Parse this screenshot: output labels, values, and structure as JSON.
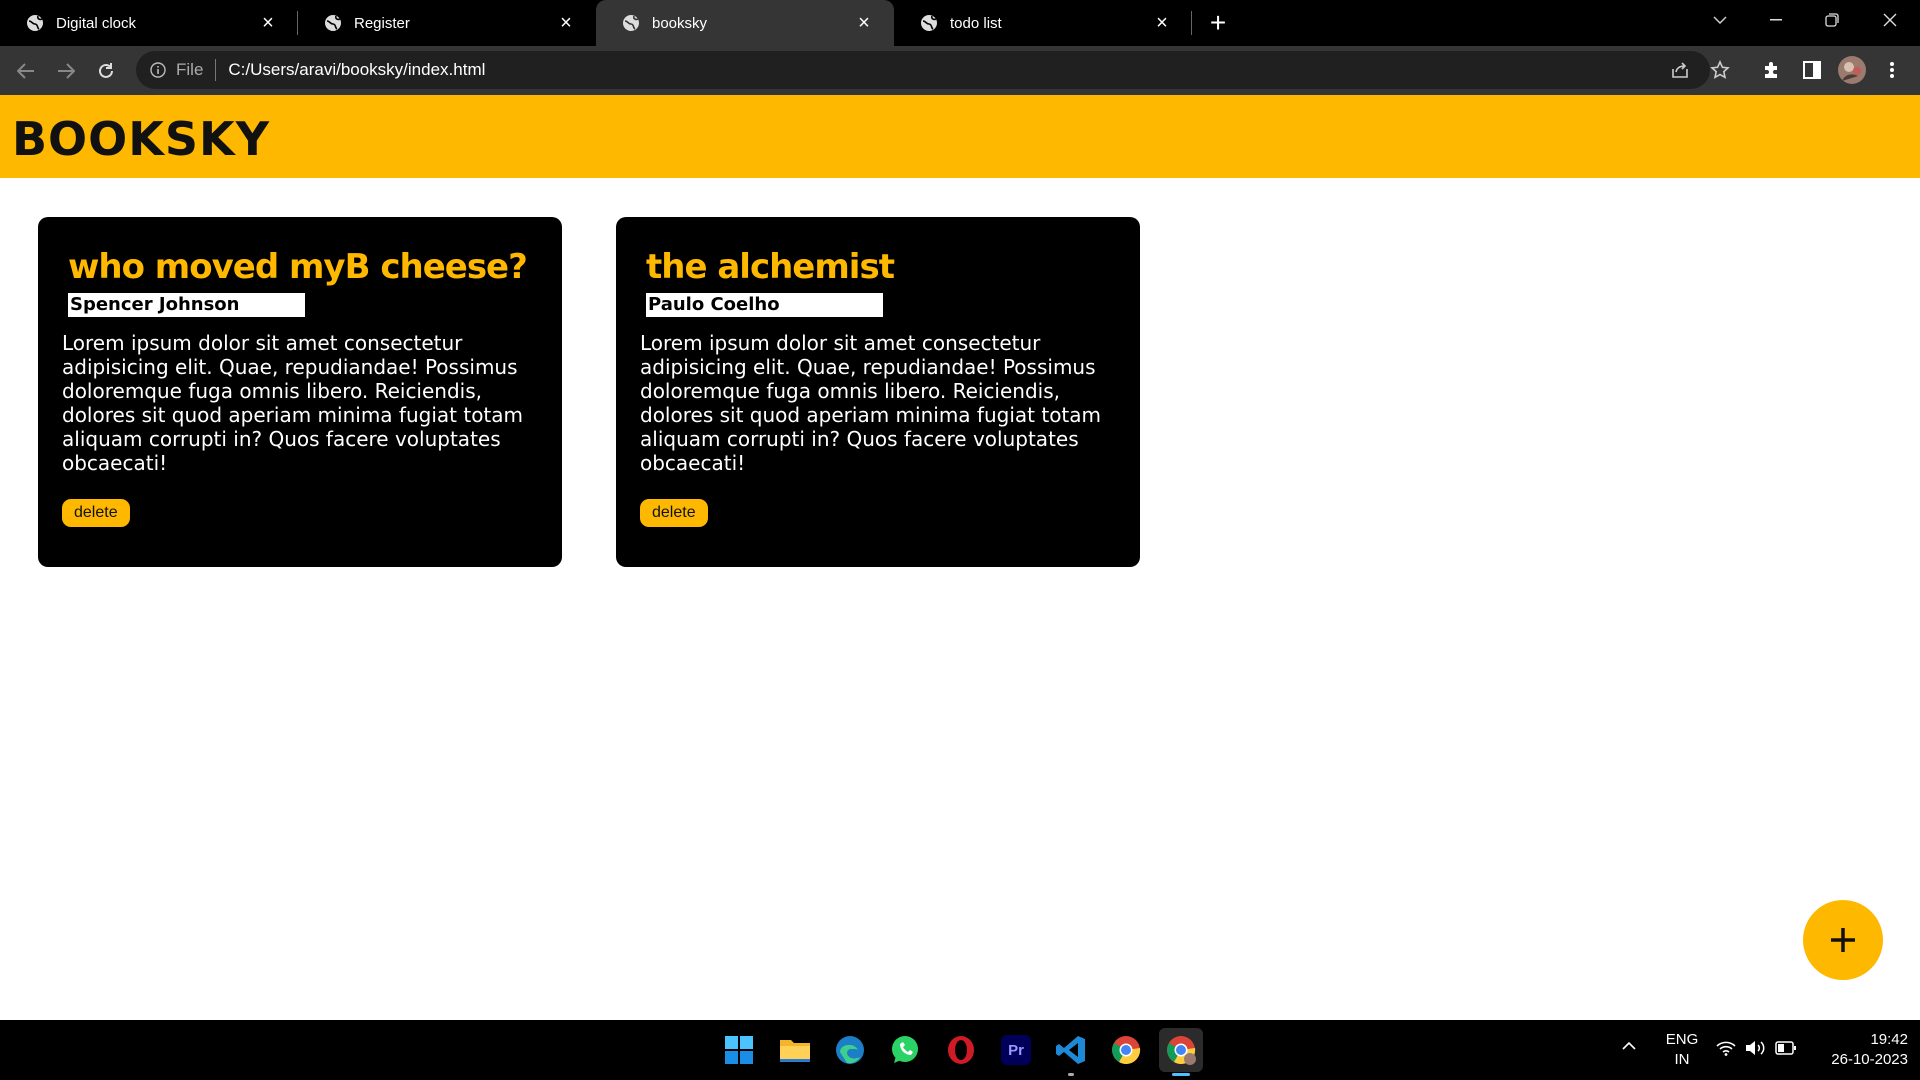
{
  "browser": {
    "tabs": [
      {
        "title": "Digital clock"
      },
      {
        "title": "Register"
      },
      {
        "title": "booksky",
        "active": true
      },
      {
        "title": "todo list"
      }
    ],
    "omnibox": {
      "scheme_label": "File",
      "url": "C:/Users/aravi/booksky/index.html"
    }
  },
  "app": {
    "logo": "BOOKSKY",
    "accent_color": "#ffb800",
    "books": [
      {
        "title": "who moved myB cheese?",
        "author": "Spencer Johnson",
        "description": "Lorem ipsum dolor sit amet consectetur adipisicing elit. Quae, repudiandae! Possimus doloremque fuga omnis libero. Reiciendis, dolores sit quod aperiam minima fugiat totam aliquam corrupti in? Quos facere voluptates obcaecati!",
        "delete_label": "delete"
      },
      {
        "title": "the alchemist",
        "author": "Paulo Coelho",
        "description": "Lorem ipsum dolor sit amet consectetur adipisicing elit. Quae, repudiandae! Possimus doloremque fuga omnis libero. Reiciendis, dolores sit quod aperiam minima fugiat totam aliquam corrupti in? Quos facere voluptates obcaecati!",
        "delete_label": "delete"
      }
    ],
    "add_button_icon": "plus-icon"
  },
  "taskbar": {
    "apps": [
      "windows-start-icon",
      "file-explorer-icon",
      "edge-icon",
      "whatsapp-icon",
      "opera-icon",
      "premiere-pro-icon",
      "vscode-icon",
      "chrome-icon",
      "chrome-profile-icon"
    ],
    "premiere_label": "Pr",
    "language": {
      "line1": "ENG",
      "line2": "IN"
    },
    "clock": {
      "time": "19:42",
      "date": "26-10-2023"
    }
  }
}
